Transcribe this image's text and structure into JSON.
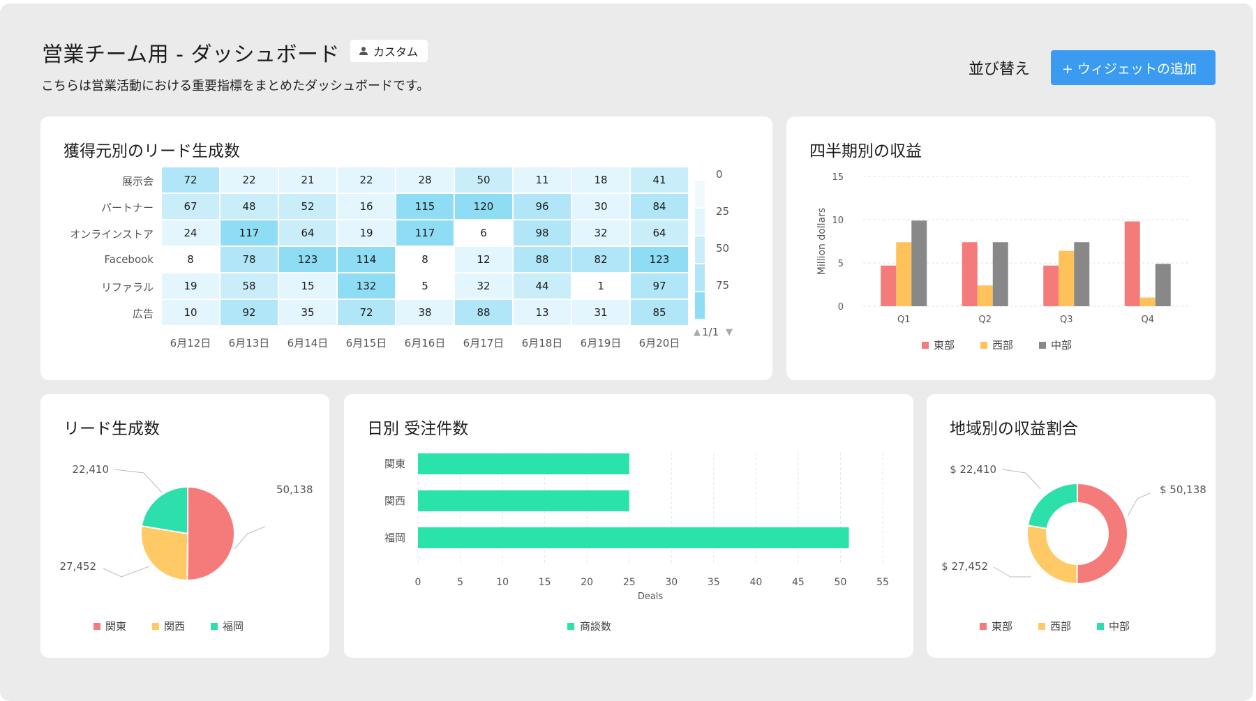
{
  "header": {
    "title": "営業チーム用 - ダッシュボード",
    "badge_label": "カスタム",
    "description": "こちらは営業活動における重要指標をまとめたダッシュボードです。",
    "sort_label": "並び替え",
    "add_widget_label": "+ ウィジェットの追加"
  },
  "heatmap": {
    "title": "獲得元別のリード生成数",
    "rows": [
      "展示会",
      "パートナー",
      "オンラインストア",
      "Facebook",
      "リファラル",
      "広告"
    ],
    "cols": [
      "6月12日",
      "6月13日",
      "6月14日",
      "6月15日",
      "6月16日",
      "6月17日",
      "6月18日",
      "6月19日",
      "6月20日"
    ],
    "values": [
      [
        72,
        22,
        21,
        22,
        28,
        50,
        11,
        18,
        41
      ],
      [
        67,
        48,
        52,
        16,
        115,
        120,
        96,
        30,
        84
      ],
      [
        24,
        117,
        64,
        19,
        117,
        6,
        98,
        32,
        64
      ],
      [
        8,
        78,
        123,
        114,
        8,
        12,
        88,
        82,
        123
      ],
      [
        19,
        58,
        15,
        132,
        5,
        32,
        44,
        1,
        97
      ],
      [
        10,
        92,
        35,
        72,
        38,
        88,
        13,
        31,
        85
      ]
    ],
    "scale_labels": [
      "0",
      "25",
      "50",
      "75"
    ],
    "pager": "1/1"
  },
  "quarterly": {
    "title": "四半期別の収益"
  },
  "leads": {
    "title": "リード生成数"
  },
  "deals": {
    "title": "日別 受注件数"
  },
  "region": {
    "title": "地域別の収益割合"
  },
  "chart_data": [
    {
      "type": "bar",
      "title": "四半期別の収益",
      "categories": [
        "Q1",
        "Q2",
        "Q3",
        "Q4"
      ],
      "series": [
        {
          "name": "東部",
          "values": [
            4.7,
            7.4,
            4.7,
            9.8
          ],
          "color": "#f47b7a"
        },
        {
          "name": "西部",
          "values": [
            7.4,
            2.4,
            6.4,
            1.0
          ],
          "color": "#ffc15a"
        },
        {
          "name": "中部",
          "values": [
            9.9,
            7.4,
            7.4,
            4.9
          ],
          "color": "#888888"
        }
      ],
      "ylabel": "Million dollars",
      "yticks": [
        "0",
        "5",
        "10",
        "15"
      ],
      "ylim": [
        0,
        15
      ],
      "grid": true,
      "legend": "bottom"
    },
    {
      "type": "pie",
      "title": "リード生成数",
      "labels": [
        "関東",
        "関西",
        "福岡"
      ],
      "values": [
        50138,
        27452,
        22410
      ],
      "value_labels": [
        "50,138",
        "27,452",
        "22,410"
      ],
      "colors": [
        "#f47b7a",
        "#ffc965",
        "#2ddfaa"
      ],
      "legend": "bottom"
    },
    {
      "type": "bar",
      "orientation": "horizontal",
      "title": "日別 受注件数",
      "categories": [
        "関東",
        "関西",
        "福岡"
      ],
      "series": [
        {
          "name": "商談数",
          "values": [
            25,
            25,
            51
          ],
          "color": "#2ae3aa"
        }
      ],
      "xlabel": "Deals",
      "xticks": [
        "0",
        "5",
        "10",
        "15",
        "20",
        "25",
        "30",
        "35",
        "40",
        "45",
        "50",
        "55"
      ],
      "xlim": [
        0,
        55
      ],
      "legend": "bottom"
    },
    {
      "type": "pie",
      "variant": "donut",
      "title": "地域別の収益割合",
      "labels": [
        "東部",
        "西部",
        "中部"
      ],
      "values": [
        50138,
        27452,
        22410
      ],
      "value_labels": [
        "$ 50,138",
        "$ 27,452",
        "$ 22,410"
      ],
      "colors": [
        "#f47b7a",
        "#ffc965",
        "#2ddfaa"
      ],
      "legend": "bottom"
    }
  ]
}
